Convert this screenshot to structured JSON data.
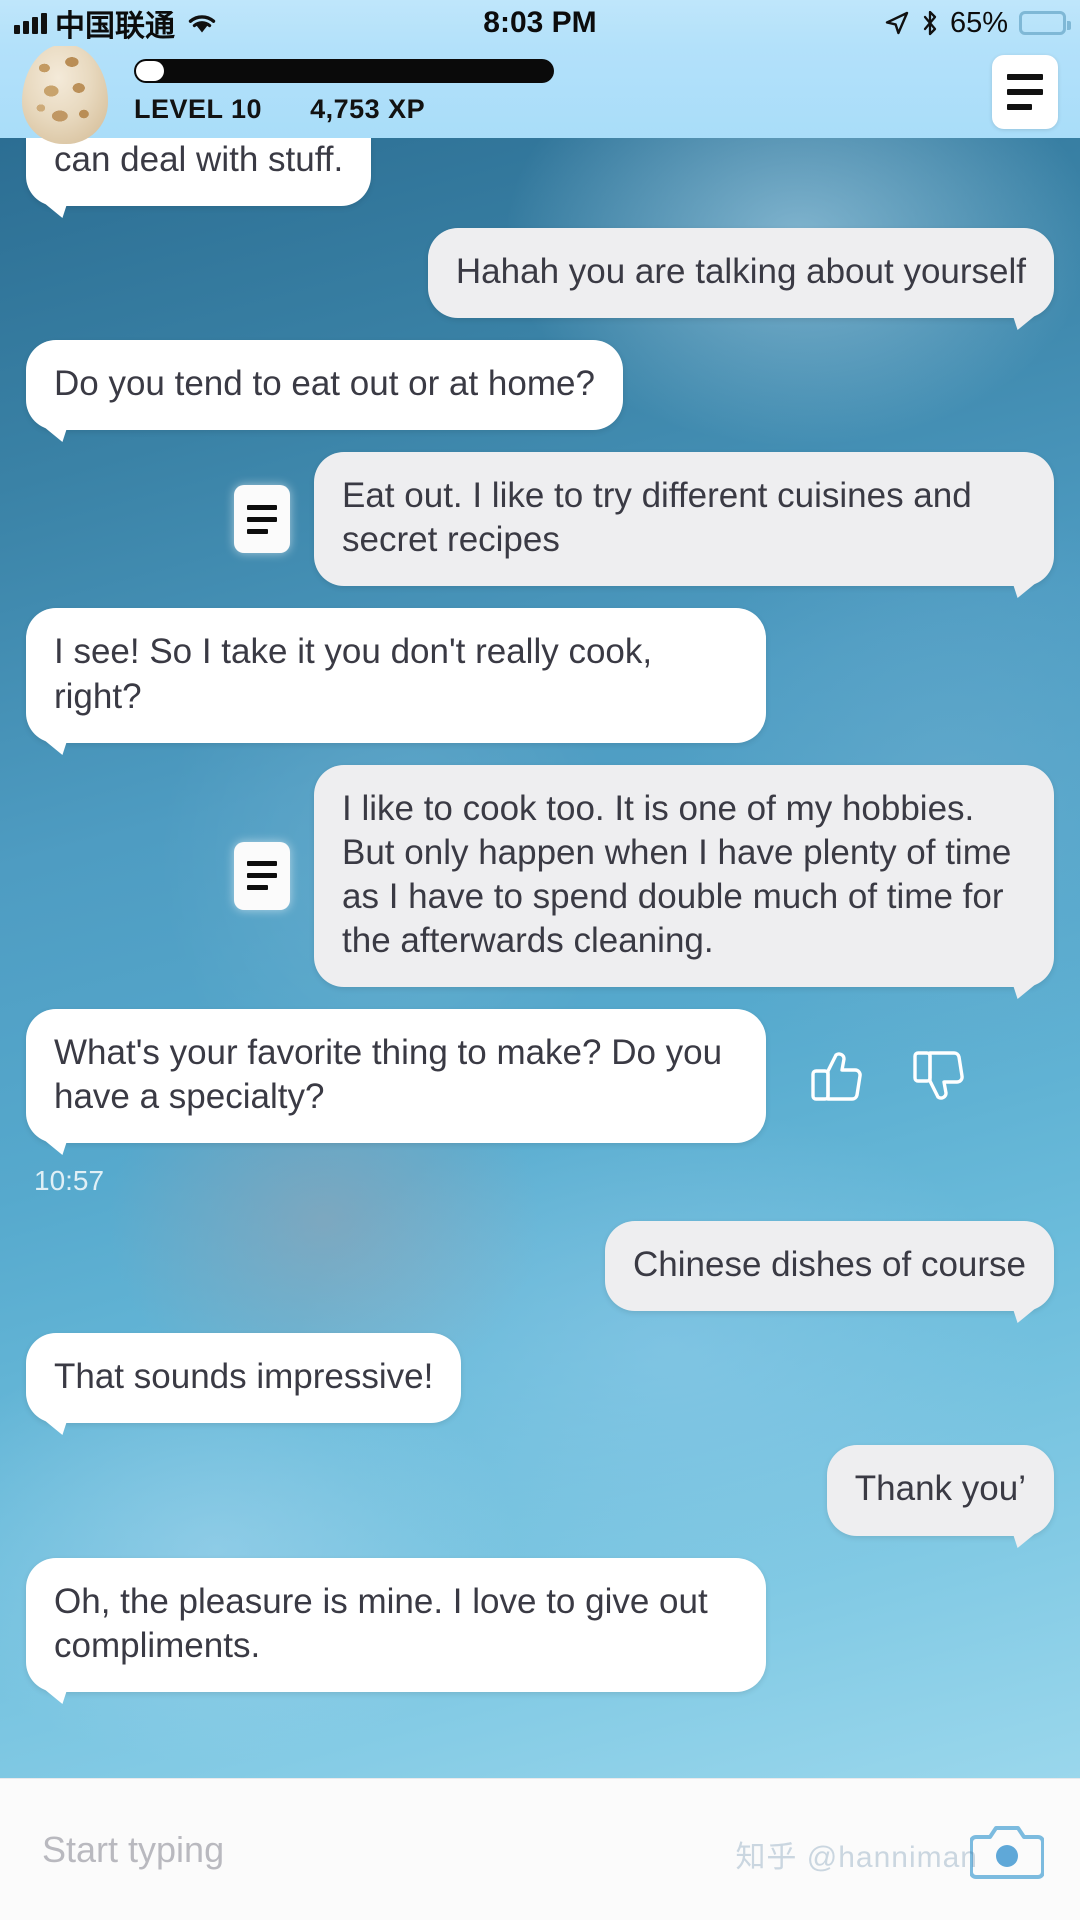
{
  "status_bar": {
    "carrier": "中国联通",
    "time": "8:03 PM",
    "battery_percent": "65%",
    "signal_icon": "signal-bars-icon",
    "wifi_icon": "wifi-icon",
    "location_icon": "location-arrow-icon",
    "bluetooth_icon": "bluetooth-icon",
    "battery_icon": "battery-icon",
    "battery_fill_color": "#fcd34d",
    "background_color": "#b3e1fa"
  },
  "header": {
    "avatar_icon": "egg-avatar",
    "level_label": "LEVEL 10",
    "xp_label": "4,753 XP",
    "xp_progress_percent": 4,
    "menu_icon": "hamburger-menu-icon"
  },
  "conversation": {
    "messages": [
      {
        "side": "in",
        "text": "can deal with stuff.",
        "clipped": true,
        "badge": false
      },
      {
        "side": "out",
        "text": "Hahah you are talking about yourself",
        "badge": false
      },
      {
        "side": "in",
        "text": "Do you tend to eat out or at home?",
        "badge": false
      },
      {
        "side": "out",
        "text": "Eat out. I like to try different cuisines and secret recipes",
        "badge": true
      },
      {
        "side": "in",
        "text": "I see! So I take it you don't really cook, right?",
        "badge": false
      },
      {
        "side": "out",
        "text": "I like to cook too. It is one of my hobbies. But only happen when I have plenty of time as I have to spend double much of time for the afterwards cleaning.",
        "badge": true
      },
      {
        "side": "in",
        "text": "What's your favorite thing to make? Do you have a specialty?",
        "badge": false,
        "reactions": true
      },
      {
        "side": "out",
        "text": "Chinese dishes of course",
        "badge": false
      },
      {
        "side": "in",
        "text": "That sounds impressive!",
        "badge": false
      },
      {
        "side": "out",
        "text": "Thank you’",
        "badge": false
      },
      {
        "side": "in",
        "text": "Oh, the pleasure is mine. I love to give out compliments.",
        "badge": false
      }
    ],
    "timestamp": "10:57",
    "thumbs_up_icon": "thumbs-up-icon",
    "thumbs_down_icon": "thumbs-down-icon",
    "transcript_badge_icon": "transcript-lines-icon"
  },
  "input_bar": {
    "placeholder": "Start typing",
    "camera_icon": "camera-icon",
    "camera_color": "#5fa8d8"
  },
  "watermark": {
    "text": "知乎 @hanniman"
  }
}
